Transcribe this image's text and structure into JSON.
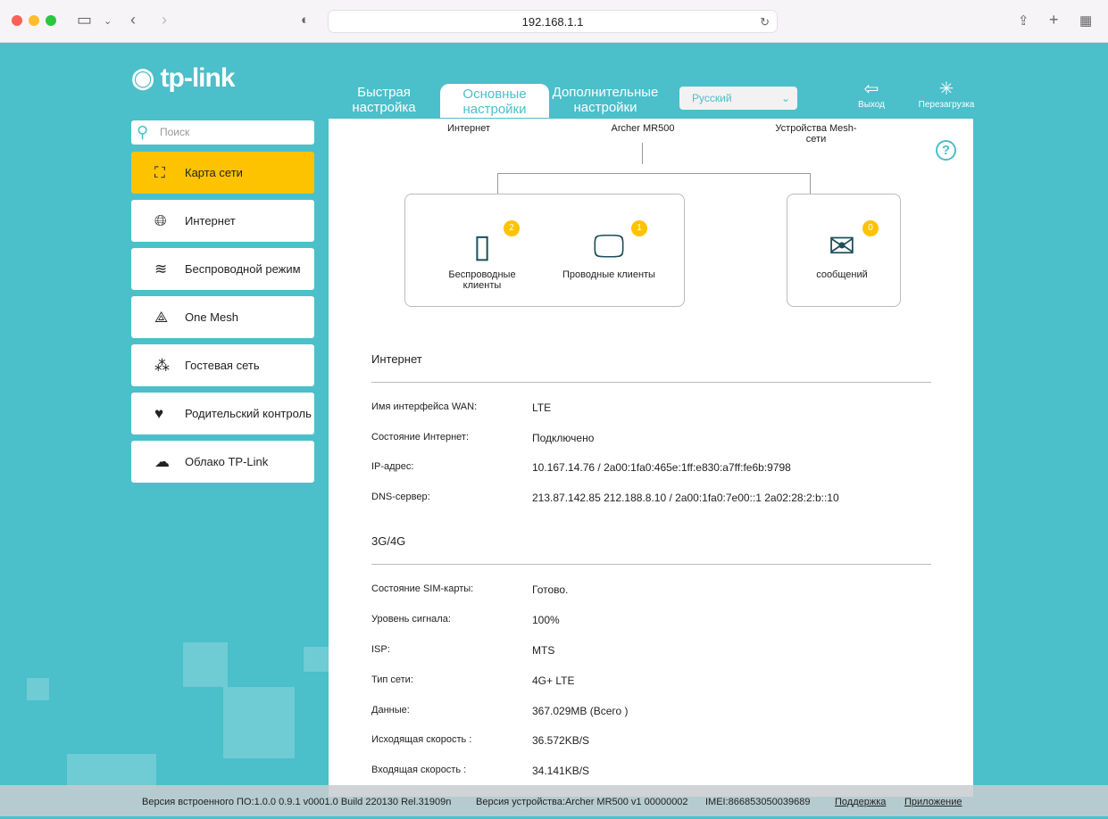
{
  "browser": {
    "url": "192.168.1.1"
  },
  "brand": {
    "logo": "tp-link"
  },
  "tabs": [
    {
      "label": "Быстрая настройка"
    },
    {
      "label": "Основные настройки"
    },
    {
      "label": "Дополнительные настройки"
    }
  ],
  "language": {
    "selected": "Русский"
  },
  "header_buttons": {
    "logout": "Выход",
    "reboot": "Перезагрузка"
  },
  "search": {
    "placeholder": "Поиск"
  },
  "sidebar": {
    "items": [
      {
        "label": "Карта сети"
      },
      {
        "label": "Интернет"
      },
      {
        "label": "Беспроводной режим"
      },
      {
        "label": "One Mesh"
      },
      {
        "label": "Гостевая сеть"
      },
      {
        "label": "Родительский контроль"
      },
      {
        "label": "Облако TP-Link"
      }
    ]
  },
  "topology": {
    "internet": "Интернет",
    "device": "Archer MR500",
    "mesh": "Устройства Mesh-сети",
    "wireless": {
      "label": "Беспроводные клиенты",
      "count": "2"
    },
    "wired": {
      "label": "Проводные клиенты",
      "count": "1"
    },
    "messages": {
      "label": "сообщений",
      "count": "0"
    }
  },
  "internet": {
    "title": "Интернет",
    "rows": [
      {
        "label": "Имя интерфейса WAN:",
        "value": "LTE"
      },
      {
        "label": "Состояние Интернет:",
        "value": "Подключено"
      },
      {
        "label": "IP-адрес:",
        "value": "10.167.14.76 / 2a00:1fa0:465e:1ff:e830:a7ff:fe6b:9798"
      },
      {
        "label": "DNS-сервер:",
        "value": "213.87.142.85 212.188.8.10 / 2a00:1fa0:7e00::1 2a02:28:2:b::10"
      }
    ]
  },
  "cellular": {
    "title": "3G/4G",
    "rows": [
      {
        "label": "Состояние SIM-карты:",
        "value": "Готово."
      },
      {
        "label": "Уровень сигнала:",
        "value": "100%"
      },
      {
        "label": "ISP:",
        "value": "MTS"
      },
      {
        "label": "Тип сети:",
        "value": "4G+ LTE"
      },
      {
        "label": "Данные:",
        "value": "367.029MB (Всего )"
      },
      {
        "label": "Исходящая скорость :",
        "value": "36.572KB/S"
      },
      {
        "label": "Входящая скорость :",
        "value": "34.141KB/S"
      }
    ]
  },
  "footer": {
    "firmware": "Версия встроенного ПО:1.0.0 0.9.1 v0001.0 Build 220130 Rel.31909n",
    "hardware": "Версия устройства:Archer MR500 v1 00000002",
    "imei": "IMEI:866853050039689",
    "support": "Поддержка",
    "app": "Приложение"
  }
}
